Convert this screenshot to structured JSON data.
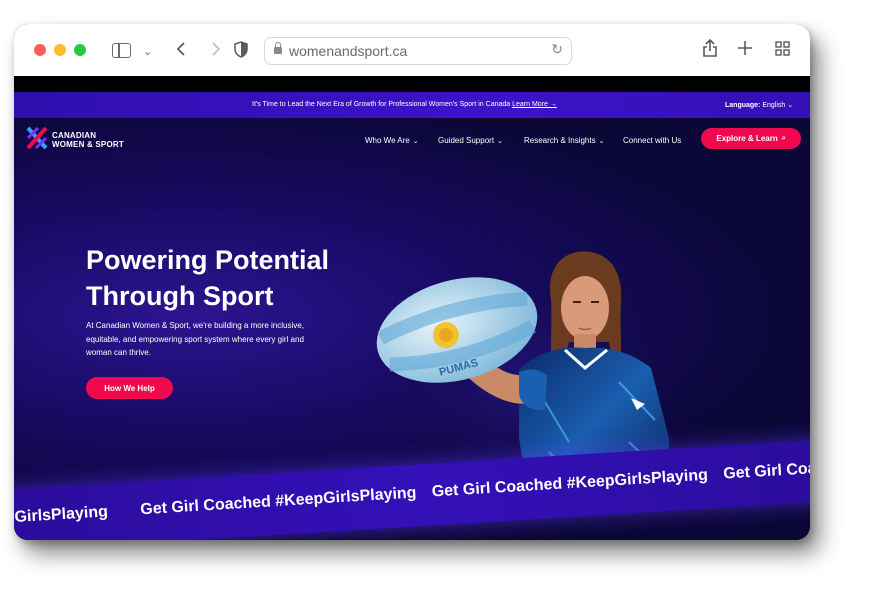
{
  "browser": {
    "url": "womenandsport.ca",
    "colors": {
      "close": "#ff5f57",
      "minimize": "#febc2e",
      "zoom": "#28c840"
    },
    "icons": [
      "sidebar-icon",
      "chevron-down-icon",
      "back-icon",
      "forward-icon",
      "shield-icon",
      "lock-icon",
      "reload-icon",
      "share-icon",
      "new-tab-icon",
      "tab-overview-icon"
    ]
  },
  "announcement": {
    "text": "It's Time to Lead the Next Era of Growth for Professional Women's Sport in Canada",
    "link": "Learn More →",
    "language_label": "Language:",
    "language_value": "English"
  },
  "brand": {
    "line1": "CANADIAN",
    "line2": "WOMEN & SPORT",
    "accent": "#f0094f",
    "primary": "#3410b5"
  },
  "nav": {
    "items": [
      {
        "label": "Who We Are"
      },
      {
        "label": "Guided Support"
      },
      {
        "label": "Research & Insights"
      },
      {
        "label": "Connect with Us"
      }
    ],
    "cta": "Explore & Learn"
  },
  "hero": {
    "title_line1": "Powering Potential",
    "title_line2": "Through Sport",
    "description": "At Canadian Women & Sport, we're building a more inclusive, equitable, and empowering sport system where every girl and woman can thrive.",
    "button": "How We Help",
    "ball_text": "PUMAS"
  },
  "ribbon": {
    "phrases": [
      "GirlsPlaying",
      "Get Girl Coached #KeepGirlsPlaying",
      "Get Girl Coached #KeepGirlsPlaying",
      "Get Girl Coac"
    ]
  }
}
